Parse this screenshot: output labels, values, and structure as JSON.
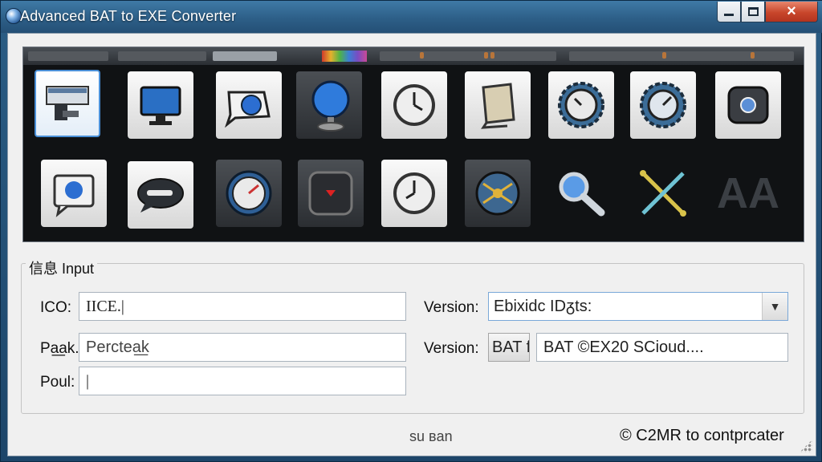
{
  "window": {
    "title": "Advanced BAT to EXE Converter",
    "controls": {
      "minimize": "minimize",
      "maximize": "maximize",
      "close": "×"
    }
  },
  "icon_gallery": {
    "row1": [
      "terminal-window-icon",
      "monitor-icon",
      "speech-bubble-globe-icon",
      "globe-stand-icon",
      "clock-icon",
      "scroll-icon",
      "gear-clock-icon",
      "gear-gauge-icon",
      "dark-button-icon"
    ],
    "row2": [
      "chat-globe-icon",
      "chat-bubble-icon",
      "speedometer-icon",
      "dark-record-icon",
      "clock-icon",
      "network-node-icon",
      "magnifier-icon",
      "cross-arrows-icon",
      "letters-icon"
    ],
    "letters_tile_text": "AA"
  },
  "info": {
    "group_title": "信息 Input",
    "ico_label": "ICO:",
    "ico_value": "IICE.|",
    "pack_label": "Pa͟ak.",
    "pack_value": "Perctea͟k",
    "pout_label": "Poul:",
    "pout_value": "|",
    "version1_label": "Version:",
    "version1_value": "Ebixidc IDᵹts:",
    "version2_label": "Version:",
    "version2_button": "BAT f",
    "version2_value": "BAT ©EX20 SCioud...."
  },
  "status": {
    "middle": "su ʙan",
    "right": "© C2MR to contprcater"
  },
  "colors": {
    "title_bar": "#2d5f88",
    "close_button": "#c8462b",
    "panel_bg": "#101214",
    "selection": "#4a90d8"
  }
}
